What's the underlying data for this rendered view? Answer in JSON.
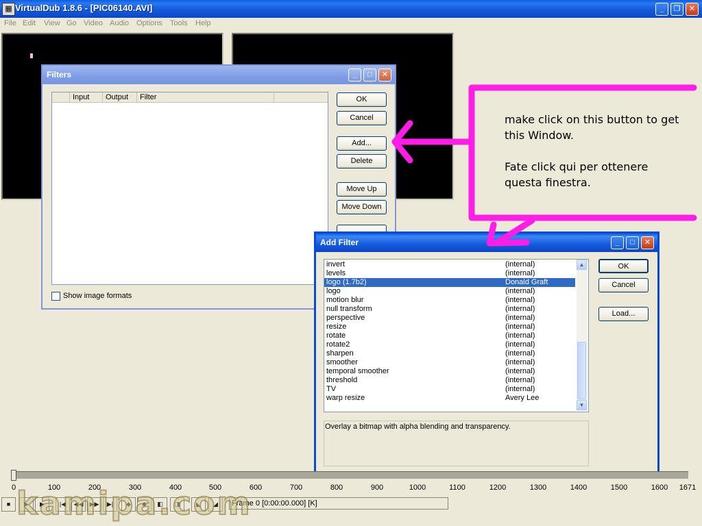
{
  "main_window": {
    "title": "VirtualDub 1.8.6 - [PIC06140.AVI]",
    "app_icon": "film-icon",
    "buttons": {
      "minimize": "minimize-icon",
      "restore": "restore-icon",
      "close": "close-icon"
    }
  },
  "menu": [
    "File",
    "Edit",
    "View",
    "Go",
    "Video",
    "Audio",
    "Options",
    "Tools",
    "Help"
  ],
  "filters_dialog": {
    "title": "Filters",
    "columns": [
      "Input",
      "Output",
      "Filter"
    ],
    "buttons": {
      "ok": "OK",
      "cancel": "Cancel",
      "add": "Add...",
      "delete": "Delete",
      "move_up": "Move Up",
      "move_down": "Move Down"
    },
    "show_image_formats": "Show image formats",
    "show_image_formats_checked": false
  },
  "add_filter_dialog": {
    "title": "Add Filter",
    "filters": [
      {
        "name": "invert",
        "author": "(internal)",
        "selected": false
      },
      {
        "name": "levels",
        "author": "(internal)",
        "selected": false
      },
      {
        "name": "logo (1.7b2)",
        "author": "Donald Graft",
        "selected": true
      },
      {
        "name": "logo",
        "author": "(internal)",
        "selected": false
      },
      {
        "name": "motion blur",
        "author": "(internal)",
        "selected": false
      },
      {
        "name": "null transform",
        "author": "(internal)",
        "selected": false
      },
      {
        "name": "perspective",
        "author": "(internal)",
        "selected": false
      },
      {
        "name": "resize",
        "author": "(internal)",
        "selected": false
      },
      {
        "name": "rotate",
        "author": "(internal)",
        "selected": false
      },
      {
        "name": "rotate2",
        "author": "(internal)",
        "selected": false
      },
      {
        "name": "sharpen",
        "author": "(internal)",
        "selected": false
      },
      {
        "name": "smoother",
        "author": "(internal)",
        "selected": false
      },
      {
        "name": "temporal smoother",
        "author": "(internal)",
        "selected": false
      },
      {
        "name": "threshold",
        "author": "(internal)",
        "selected": false
      },
      {
        "name": "TV",
        "author": "(internal)",
        "selected": false
      },
      {
        "name": "warp resize",
        "author": "Avery Lee",
        "selected": false
      }
    ],
    "description": "Overlay a bitmap with alpha blending and transparency.",
    "buttons": {
      "ok": "OK",
      "cancel": "Cancel",
      "load": "Load..."
    }
  },
  "annotation": {
    "line1": "make click on this button to get",
    "line2": "this Window.",
    "line3": "Fate click qui per ottenere",
    "line4": "questa finestra.",
    "color": "#ff1ee6"
  },
  "timeline": {
    "ticks": [
      "0",
      "100",
      "200",
      "300",
      "400",
      "500",
      "600",
      "700",
      "800",
      "900",
      "1000",
      "1100",
      "1200",
      "1300",
      "1400",
      "1500",
      "1600",
      "1671"
    ],
    "frame_label": "Frame 0 [0:00:00.000] [K]"
  },
  "watermark": "kamipa.com"
}
